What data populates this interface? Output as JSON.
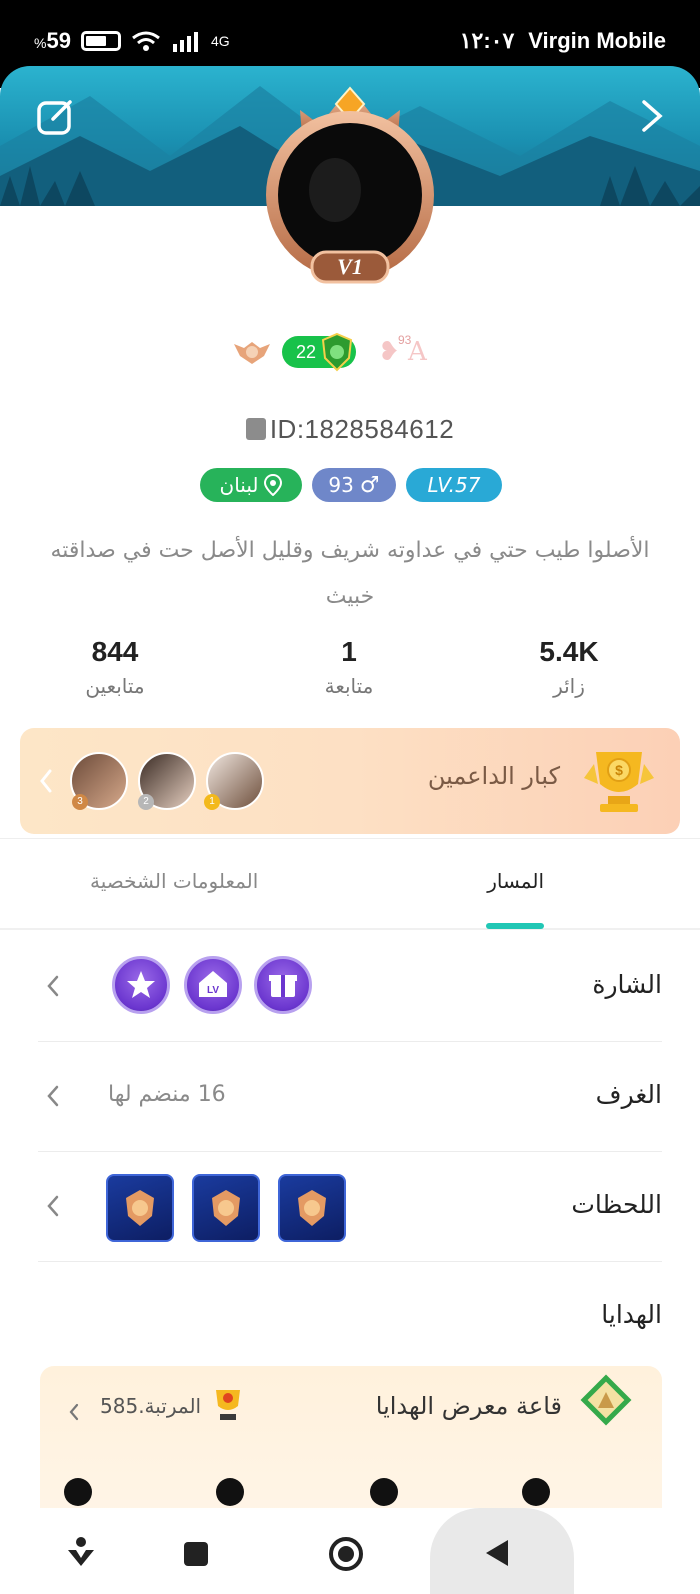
{
  "status_bar": {
    "battery_percent": "59",
    "battery_symbol": "%",
    "network": "4G",
    "time": "١٢:٠٧",
    "carrier": "Virgin Mobile"
  },
  "profile": {
    "avatar_level_badge": "V1",
    "level_pill_value": "22",
    "user_id": "ID:1828584612",
    "country_tag": "لبنان",
    "gender_age_tag": "93",
    "lv_tag": "LV.57",
    "bio": "الأصلوا طيب حتي في عداوته شريف وقليل الأصل حت في صداقته خبيث"
  },
  "stats": [
    {
      "value": "5.4K",
      "label": "زائر"
    },
    {
      "value": "1",
      "label": "متابعة"
    },
    {
      "value": "844",
      "label": "متابعين"
    }
  ],
  "supporters": {
    "title": "كبار الداعمين",
    "ranks": [
      "1",
      "2",
      "3"
    ]
  },
  "tabs": {
    "active": "المسار",
    "inactive": "المعلومات الشخصية"
  },
  "rows": {
    "badges_label": "الشارة",
    "rooms_label": "الغرف",
    "rooms_value": "16 منضم لها",
    "moments_label": "اللحظات",
    "gifts_label": "الهدايا"
  },
  "gift_hall": {
    "title": "قاعة معرض الهدايا",
    "rank_text": "المرتبة.585"
  },
  "colors": {
    "accent": "#21c7b5",
    "green_pill": "#18c24a",
    "country_tag": "#27b35a",
    "gender_tag": "#6f87c9",
    "level_tag": "#29a9d6"
  },
  "icons": [
    "edit-icon",
    "chevron-right-icon",
    "copy-icon",
    "location-pin-icon",
    "male-icon",
    "trophy-icon",
    "chevron-left-icon",
    "nav-down-icon",
    "nav-square-icon",
    "nav-circle-icon",
    "nav-back-icon"
  ]
}
